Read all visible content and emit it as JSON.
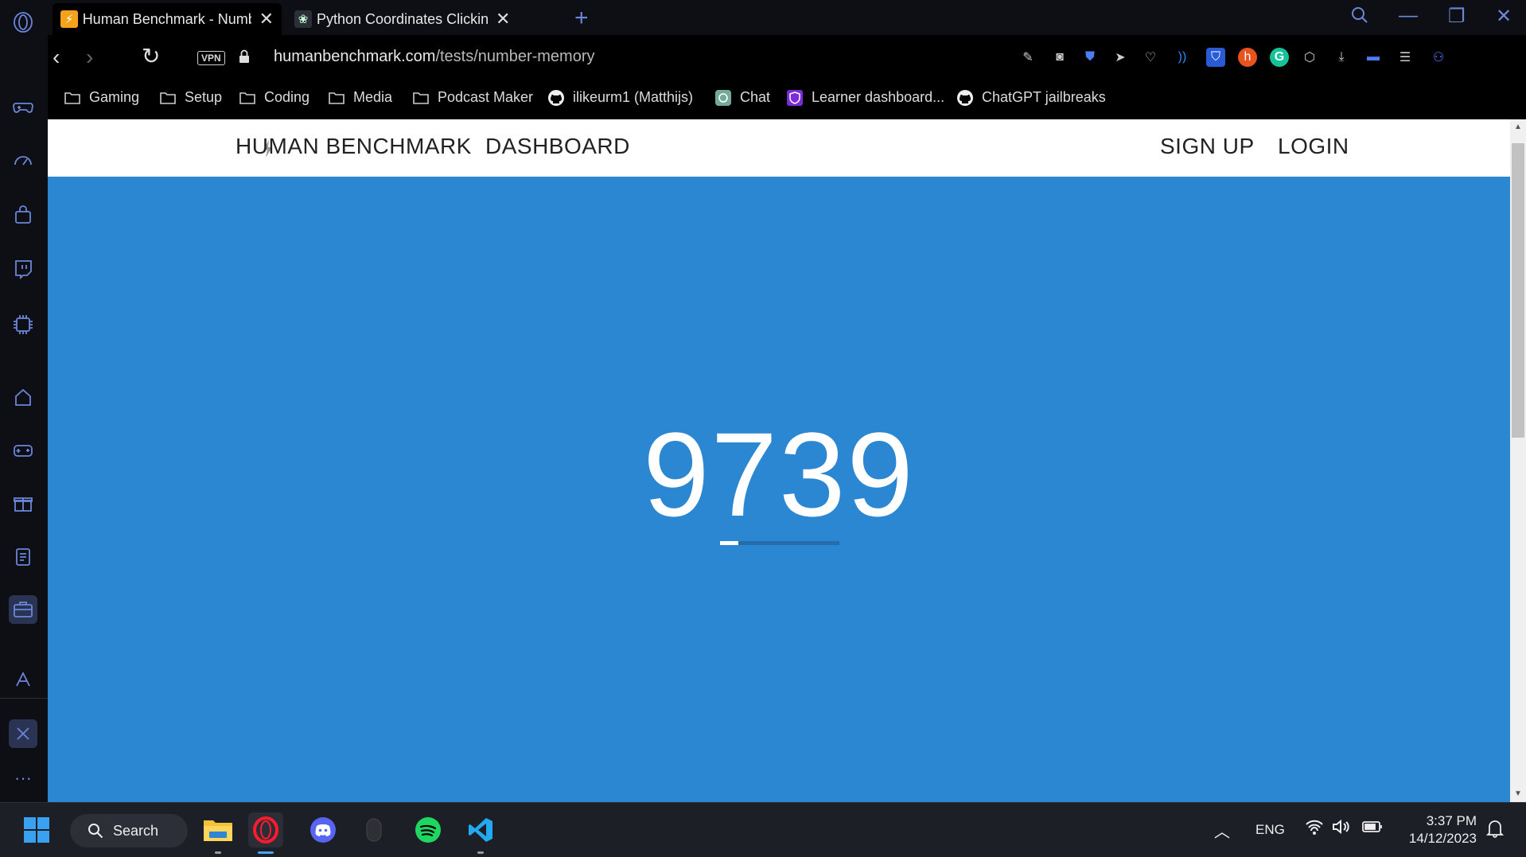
{
  "browser": {
    "tabs": [
      {
        "title": "Human Benchmark - Numb",
        "favicon": "lightning-bolt-icon",
        "active": true
      },
      {
        "title": "Python Coordinates Clickin",
        "favicon": "chatgpt-icon",
        "active": false
      }
    ],
    "address": {
      "vpn_label": "VPN",
      "url_host": "humanbenchmark.com",
      "url_path": "/tests/number-memory"
    },
    "bookmarks": [
      {
        "label": "Gaming",
        "icon": "folder-icon"
      },
      {
        "label": "Setup",
        "icon": "folder-icon"
      },
      {
        "label": "Coding",
        "icon": "folder-icon"
      },
      {
        "label": "Media",
        "icon": "folder-icon"
      },
      {
        "label": "Podcast Maker",
        "icon": "folder-icon"
      },
      {
        "label": "ilikeurm1 (Matthijs)",
        "icon": "github-icon"
      },
      {
        "label": "Chat",
        "icon": "chatgpt-icon"
      },
      {
        "label": "Learner dashboard...",
        "icon": "shield-icon"
      },
      {
        "label": "ChatGPT jailbreaks",
        "icon": "github-icon"
      }
    ]
  },
  "page": {
    "nav": {
      "brand": "HUMAN BENCHMARK",
      "dashboard": "DASHBOARD",
      "signup": "SIGN UP",
      "login": "LOGIN"
    },
    "test": {
      "number": "9739",
      "timer_progress_fraction": 0.15
    },
    "colors": {
      "background": "#2b87d1",
      "text": "#ffffff"
    }
  },
  "taskbar": {
    "search_label": "Search",
    "language": "ENG",
    "time": "3:37 PM",
    "date": "14/12/2023"
  }
}
